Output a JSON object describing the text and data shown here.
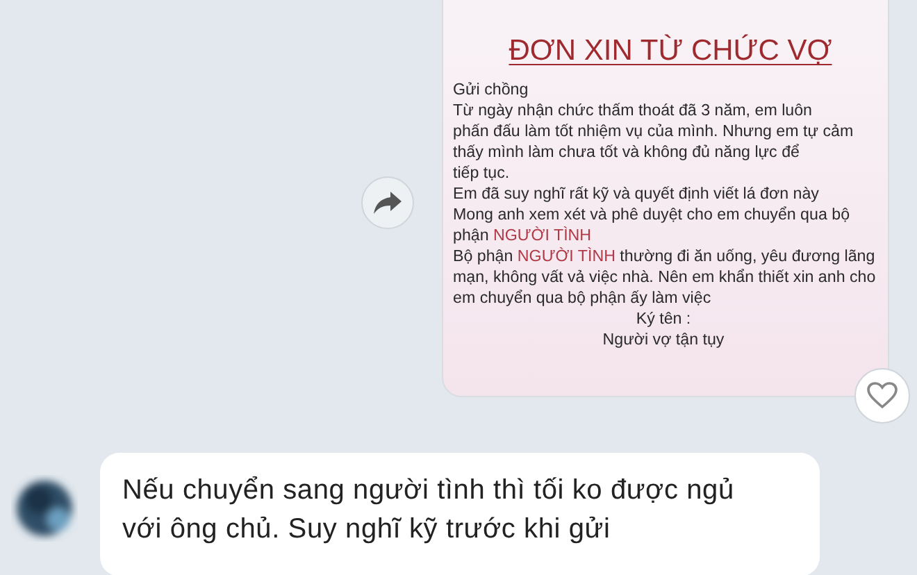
{
  "shared_image": {
    "title": "ĐƠN XIN TỪ CHỨC VỢ",
    "lines": [
      {
        "parts": [
          {
            "text": "Gửi chồng",
            "highlight": false
          }
        ]
      },
      {
        "parts": [
          {
            "text": "Từ ngày nhận chức thấm thoát đã 3 năm, em luôn",
            "highlight": false
          }
        ]
      },
      {
        "parts": [
          {
            "text": "phấn đấu làm tốt nhiệm vụ của mình. Nhưng em tự cảm",
            "highlight": false
          }
        ]
      },
      {
        "parts": [
          {
            "text": "thấy mình làm chưa tốt và không đủ năng lực để",
            "highlight": false
          }
        ]
      },
      {
        "parts": [
          {
            "text": "tiếp tục.",
            "highlight": false
          }
        ]
      },
      {
        "parts": [
          {
            "text": "Em đã suy nghĩ rất kỹ và quyết định viết lá đơn này",
            "highlight": false
          }
        ]
      },
      {
        "parts": [
          {
            "text": "Mong anh xem xét và phê duyệt cho em chuyển qua bộ",
            "highlight": false
          }
        ]
      },
      {
        "parts": [
          {
            "text": "phận ",
            "highlight": false
          },
          {
            "text": "NGƯỜI TÌNH",
            "highlight": true
          }
        ]
      },
      {
        "parts": [
          {
            "text": "Bộ phận ",
            "highlight": false
          },
          {
            "text": "NGƯỜI TÌNH",
            "highlight": true
          },
          {
            "text": " thường đi ăn uống, yêu đương lãng",
            "highlight": false
          }
        ]
      },
      {
        "parts": [
          {
            "text": "mạn, không vất vả việc nhà. Nên em khẩn thiết xin anh cho",
            "highlight": false
          }
        ]
      },
      {
        "parts": [
          {
            "text": "em chuyển qua bộ phận ấy làm việc",
            "highlight": false
          }
        ]
      }
    ],
    "signature": [
      "Ký tên :",
      "Người vợ tận tụy"
    ]
  },
  "reply": {
    "text": "Nếu chuyển sang người tình thì tối ko được ngủ với ông chủ. Suy nghĩ kỹ trước khi gửi"
  }
}
